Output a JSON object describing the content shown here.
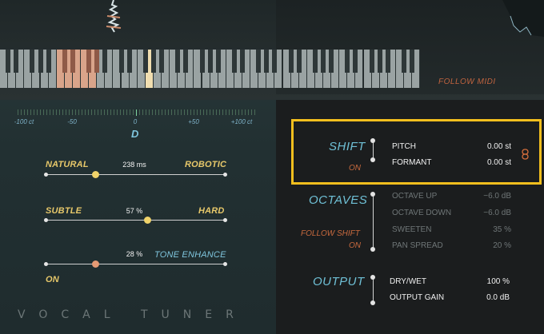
{
  "keyboard": {
    "follow_midi": "FOLLOW MIDI"
  },
  "meter": {
    "labels": [
      "-100 ct",
      "-50",
      "0",
      "+50",
      "+100 ct"
    ],
    "note": "D"
  },
  "sliders": [
    {
      "left_label": "NATURAL",
      "right_label": "ROBOTIC",
      "value": "238 ms",
      "position": 0.28,
      "thumb_color": "#f0d36a"
    },
    {
      "left_label": "SUBTLE",
      "right_label": "HARD",
      "value": "57 %",
      "position": 0.57,
      "thumb_color": "#f0d36a"
    },
    {
      "left_label": "ON",
      "right_label": "TONE ENHANCE",
      "value": "28 %",
      "position": 0.28,
      "thumb_color": "#e59a74"
    }
  ],
  "footer": {
    "title": "VOCAL TUNER"
  },
  "shift": {
    "title": "SHIFT",
    "status": "ON",
    "params": [
      {
        "name": "PITCH",
        "value": "0.00 st"
      },
      {
        "name": "FORMANT",
        "value": "0.00 st"
      }
    ]
  },
  "octaves": {
    "title": "OCTAVES",
    "follow_label": "FOLLOW SHIFT",
    "status": "ON",
    "params": [
      {
        "name": "OCTAVE UP",
        "value": "−6.0 dB"
      },
      {
        "name": "OCTAVE DOWN",
        "value": "−6.0 dB"
      },
      {
        "name": "SWEETEN",
        "value": "35 %"
      },
      {
        "name": "PAN SPREAD",
        "value": "20 %"
      }
    ]
  },
  "output": {
    "title": "OUTPUT",
    "params": [
      {
        "name": "DRY/WET",
        "value": "100 %"
      },
      {
        "name": "OUTPUT GAIN",
        "value": "0.0 dB"
      }
    ]
  },
  "colors": {
    "accent_yellow": "#e7c86a",
    "accent_blue": "#6fc0d6",
    "accent_orange": "#c96a3e",
    "highlight": "#f3bf1e"
  },
  "icons": {
    "link": "link-icon"
  }
}
